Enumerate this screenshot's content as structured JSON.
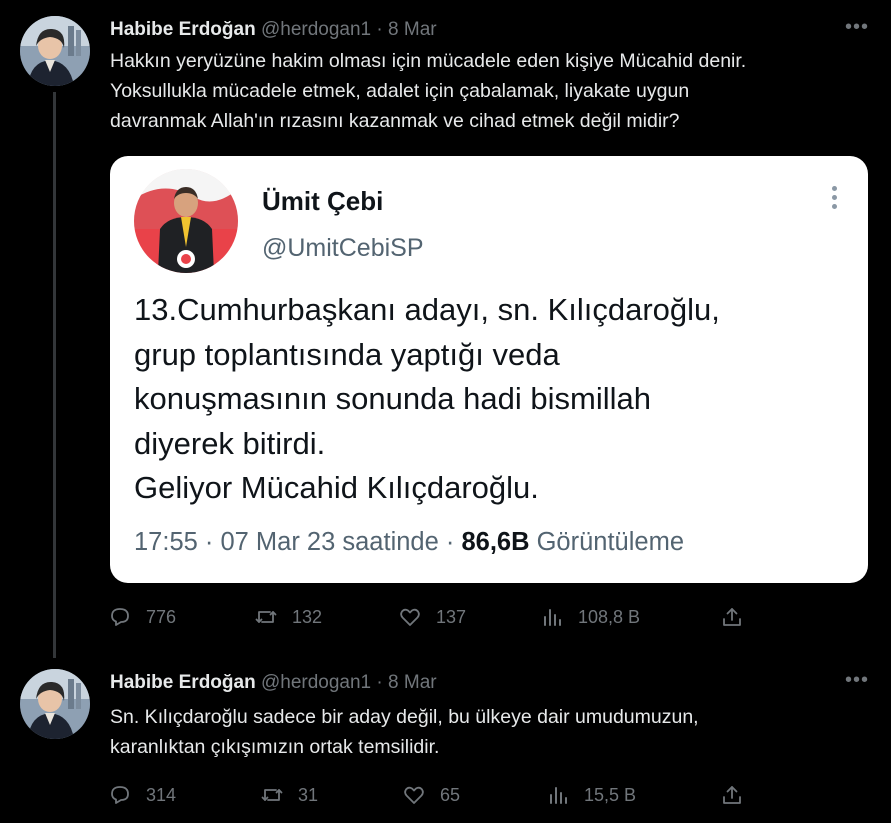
{
  "tweets": [
    {
      "author_name": "Habibe Erdoğan",
      "handle": "@herdogan1",
      "separator": "·",
      "date": "8 Mar",
      "more": "•••",
      "text_lines": [
        "Hakkın yeryüzüne hakim olması için mücadele eden kişiye Mücahid denir.",
        "Yoksullukla mücadele etmek, adalet için çabalamak, liyakate uygun",
        "davranmak Allah'ın rızasını kazanmak ve cihad etmek değil midir?"
      ],
      "quote": {
        "author_name": "Ümit Çebi",
        "handle": "@UmitCebiSP",
        "text_lines": [
          "13.Cumhurbaşkanı adayı, sn. Kılıçdaroğlu,",
          "grup toplantısında  yaptığı veda",
          "konuşmasının sonunda hadi bismillah",
          "diyerek bitirdi.",
          "Geliyor Mücahid Kılıçdaroğlu."
        ],
        "time": "17:55 · 07 Mar 23 saatinde ·",
        "views": "86,6B",
        "views_label": "Görüntüleme"
      },
      "stats": {
        "replies": "776",
        "retweets": "132",
        "likes": "137",
        "views": "108,8 B"
      }
    },
    {
      "author_name": "Habibe Erdoğan",
      "handle": "@herdogan1",
      "separator": "·",
      "date": "8 Mar",
      "more": "•••",
      "text_lines": [
        "Sn. Kılıçdaroğlu sadece bir aday değil, bu ülkeye dair umudumuzun,",
        "karanlıktan çıkışımızın ortak temsilidir."
      ],
      "stats": {
        "replies": "314",
        "retweets": "31",
        "likes": "65",
        "views": "15,5 B"
      }
    }
  ],
  "colors": {
    "background": "#000000",
    "text": "#e7e9ea",
    "muted": "#71767b",
    "quote_bg": "#ffffff",
    "quote_muted": "#536471"
  }
}
